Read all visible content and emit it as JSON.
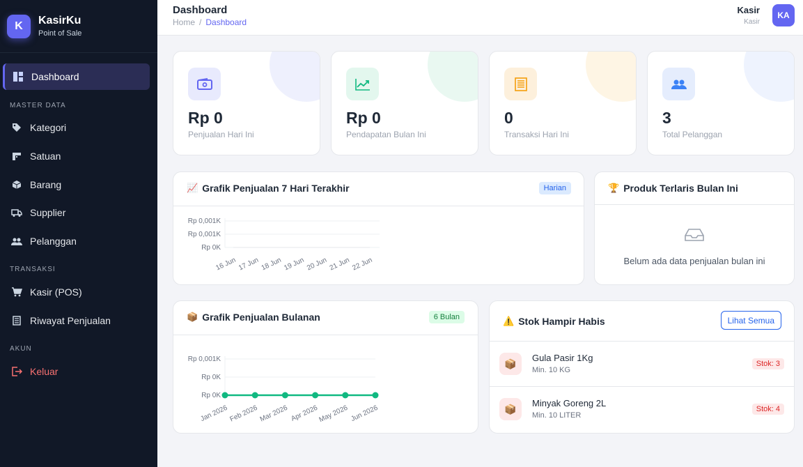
{
  "brand": {
    "logo_letter": "K",
    "name": "KasirKu",
    "subtitle": "Point of Sale"
  },
  "sidebar": {
    "active": {
      "label": "Dashboard",
      "icon": "dashboard-icon"
    },
    "sections": [
      {
        "title": "MASTER DATA",
        "items": [
          {
            "label": "Kategori",
            "icon": "tag-icon"
          },
          {
            "label": "Satuan",
            "icon": "ruler-icon"
          },
          {
            "label": "Barang",
            "icon": "box-icon"
          },
          {
            "label": "Supplier",
            "icon": "truck-icon"
          },
          {
            "label": "Pelanggan",
            "icon": "users-icon"
          }
        ]
      },
      {
        "title": "TRANSAKSI",
        "items": [
          {
            "label": "Kasir (POS)",
            "icon": "cart-icon"
          },
          {
            "label": "Riwayat Penjualan",
            "icon": "receipt-icon"
          }
        ]
      },
      {
        "title": "AKUN",
        "items": [
          {
            "label": "Keluar",
            "icon": "logout-icon"
          }
        ]
      }
    ]
  },
  "header": {
    "title": "Dashboard",
    "breadcrumb": [
      "Home",
      "Dashboard"
    ],
    "breadcrumb_sep": "/",
    "user": {
      "name": "Kasir",
      "role": "Kasir",
      "initials": "KA"
    }
  },
  "stats": [
    {
      "value": "Rp 0",
      "label": "Penjualan Hari Ini",
      "icon": "wallet-icon",
      "color": "#6366f1"
    },
    {
      "value": "Rp 0",
      "label": "Pendapatan Bulan Ini",
      "icon": "trend-up-icon",
      "color": "#10b981"
    },
    {
      "value": "0",
      "label": "Transaksi Hari Ini",
      "icon": "receipt-icon",
      "color": "#f59e0b"
    },
    {
      "value": "3",
      "label": "Total Pelanggan",
      "icon": "users-icon",
      "color": "#3b82f6"
    }
  ],
  "sales7": {
    "title": "Grafik Penjualan 7 Hari Terakhir",
    "emoji": "📈",
    "badge": "Harian"
  },
  "topProducts": {
    "title": "Produk Terlaris Bulan Ini",
    "emoji": "🏆",
    "empty_text": "Belum ada data penjualan bulan ini",
    "empty_icon": "inbox-icon"
  },
  "monthly": {
    "title": "Grafik Penjualan Bulanan",
    "emoji": "📦",
    "badge": "6 Bulan"
  },
  "lowStock": {
    "title": "Stok Hampir Habis",
    "emoji": "⚠️",
    "action": "Lihat Semua",
    "items": [
      {
        "name": "Gula Pasir 1Kg",
        "min": "Min. 10 KG",
        "stock": "Stok: 3",
        "emoji": "📦"
      },
      {
        "name": "Minyak Goreng 2L",
        "min": "Min. 10 LITER",
        "stock": "Stok: 4",
        "emoji": "📦"
      }
    ]
  },
  "chart_data": [
    {
      "type": "line",
      "categories": [
        "16 Jun",
        "17 Jun",
        "18 Jun",
        "19 Jun",
        "20 Jun",
        "21 Jun",
        "22 Jun"
      ],
      "y_tick_labels": [
        "Rp 0,001K",
        "Rp 0,001K",
        "Rp 0K"
      ],
      "series": [
        {
          "values": [
            0,
            0,
            0,
            0,
            0,
            0,
            0
          ]
        }
      ],
      "title": "",
      "xlabel": "",
      "ylabel": "",
      "grid": true
    },
    {
      "type": "line",
      "categories": [
        "Jan 2026",
        "Feb 2026",
        "Mar 2026",
        "Apr 2026",
        "May 2026",
        "Jun 2026"
      ],
      "y_tick_labels": [
        "Rp 0,001K",
        "Rp 0K",
        "Rp 0K"
      ],
      "series": [
        {
          "values": [
            0,
            0,
            0,
            0,
            0,
            0
          ],
          "color": "#10b981"
        }
      ],
      "title": "",
      "xlabel": "",
      "ylabel": "",
      "grid": true
    }
  ]
}
